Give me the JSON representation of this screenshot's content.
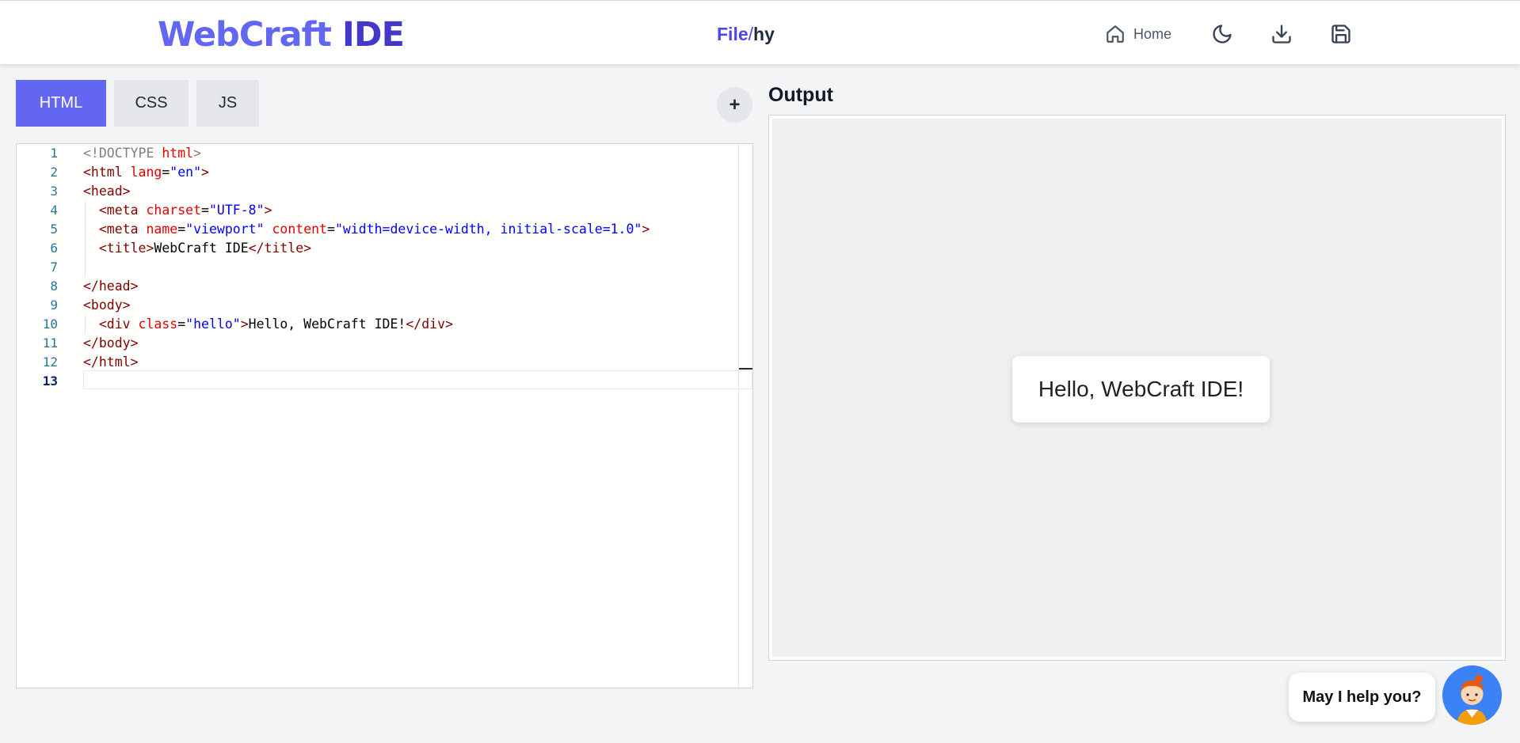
{
  "header": {
    "logo_part1": "WebCraft",
    "logo_part2": "IDE",
    "breadcrumb_root": "File",
    "breadcrumb_sep": "/",
    "breadcrumb_current": "hy",
    "home_label": "Home",
    "icons": [
      "home-icon",
      "moon-icon",
      "download-icon",
      "save-icon"
    ]
  },
  "tabs": [
    {
      "label": "HTML",
      "active": true
    },
    {
      "label": "CSS",
      "active": false
    },
    {
      "label": "JS",
      "active": false
    }
  ],
  "add_button_label": "+",
  "editor": {
    "line_numbers": [
      "1",
      "2",
      "3",
      "4",
      "5",
      "6",
      "7",
      "8",
      "9",
      "10",
      "11",
      "12",
      "13"
    ],
    "current_line": 13,
    "lines": [
      [
        [
          "t-doc",
          "<!DOCTYPE "
        ],
        [
          "t-attr",
          "html"
        ],
        [
          "t-doc",
          ">"
        ]
      ],
      [
        [
          "t-tag",
          "<html "
        ],
        [
          "t-attr",
          "lang"
        ],
        [
          "t-txt",
          "="
        ],
        [
          "t-val",
          "\"en\""
        ],
        [
          "t-tag",
          ">"
        ]
      ],
      [
        [
          "t-tag",
          "<head>"
        ]
      ],
      [
        [
          "t-txt",
          "  "
        ],
        [
          "t-tag",
          "<meta "
        ],
        [
          "t-attr",
          "charset"
        ],
        [
          "t-txt",
          "="
        ],
        [
          "t-val",
          "\"UTF-8\""
        ],
        [
          "t-tag",
          ">"
        ]
      ],
      [
        [
          "t-txt",
          "  "
        ],
        [
          "t-tag",
          "<meta "
        ],
        [
          "t-attr",
          "name"
        ],
        [
          "t-txt",
          "="
        ],
        [
          "t-val",
          "\"viewport\""
        ],
        [
          "t-txt",
          " "
        ],
        [
          "t-attr",
          "content"
        ],
        [
          "t-txt",
          "="
        ],
        [
          "t-val",
          "\"width=device-width, initial-scale=1.0\""
        ],
        [
          "t-tag",
          ">"
        ]
      ],
      [
        [
          "t-txt",
          "  "
        ],
        [
          "t-tag",
          "<title>"
        ],
        [
          "t-txt",
          "WebCraft IDE"
        ],
        [
          "t-tag",
          "</title>"
        ]
      ],
      [
        [
          "t-txt",
          ""
        ]
      ],
      [
        [
          "t-tag",
          "</head>"
        ]
      ],
      [
        [
          "t-tag",
          "<body>"
        ]
      ],
      [
        [
          "t-txt",
          "  "
        ],
        [
          "t-tag",
          "<div "
        ],
        [
          "t-attr",
          "class"
        ],
        [
          "t-txt",
          "="
        ],
        [
          "t-val",
          "\"hello\""
        ],
        [
          "t-tag",
          ">"
        ],
        [
          "t-txt",
          "Hello, WebCraft IDE!"
        ],
        [
          "t-tag",
          "</div>"
        ]
      ],
      [
        [
          "t-tag",
          "</body>"
        ]
      ],
      [
        [
          "t-tag",
          "</html>"
        ]
      ],
      [
        [
          "t-txt",
          ""
        ]
      ]
    ]
  },
  "output": {
    "title": "Output",
    "content": "Hello, WebCraft IDE!"
  },
  "help": {
    "label": "May I help you?",
    "avatar_icon": "assistant-avatar-icon"
  }
}
